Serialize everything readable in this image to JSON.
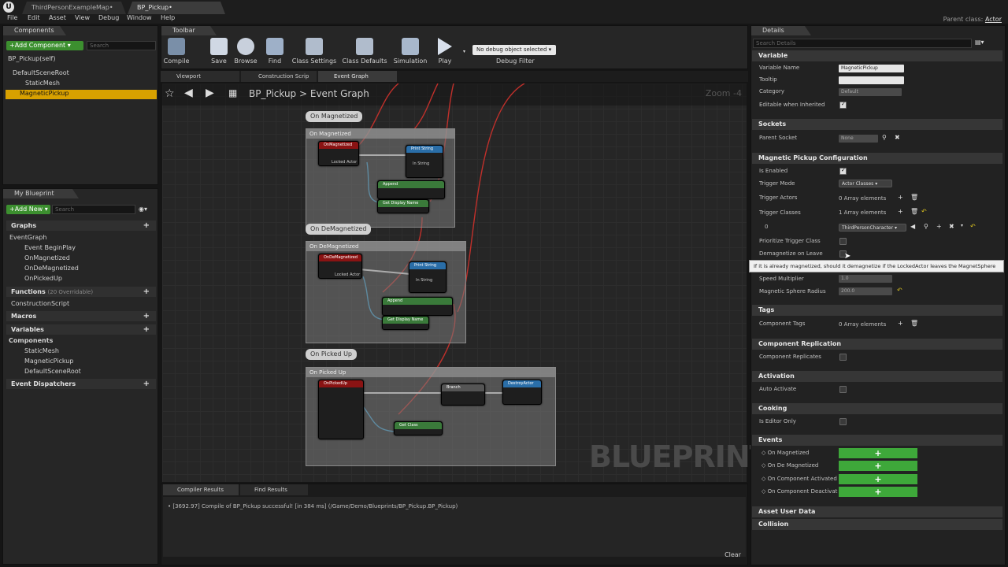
{
  "window": {
    "doc_tabs": [
      "ThirdPersonExampleMap•",
      "BP_Pickup•"
    ],
    "menu": [
      "File",
      "Edit",
      "Asset",
      "View",
      "Debug",
      "Window",
      "Help"
    ],
    "parent_class_label": "Parent class:",
    "parent_class_value": "Actor"
  },
  "components": {
    "title": "Components",
    "add_button": "+Add Component ▾",
    "search_placeholder": "Search",
    "items": [
      "BP_Pickup(self)",
      "DefaultSceneRoot",
      "StaticMesh",
      "MagneticPickup"
    ],
    "selected": "MagneticPickup"
  },
  "my_blueprint": {
    "title": "My Blueprint",
    "add_button": "+Add New ▾",
    "search_placeholder": "Search",
    "graphs_label": "Graphs",
    "event_graph": "EventGraph",
    "graph_items": [
      "Event BeginPlay",
      "OnMagnetized",
      "OnDeMagnetized",
      "OnPickedUp"
    ],
    "functions_label": "Functions",
    "functions_count": "(20 Overridable)",
    "function_items": [
      "ConstructionScript"
    ],
    "macros_label": "Macros",
    "variables_label": "Variables",
    "components_label": "Components",
    "variable_components": [
      "StaticMesh",
      "MagneticPickup",
      "DefaultSceneRoot"
    ],
    "dispatchers_label": "Event Dispatchers"
  },
  "toolbar": {
    "title": "Toolbar",
    "buttons": [
      "Compile",
      "Save",
      "Browse",
      "Find",
      "Class Settings",
      "Class Defaults",
      "Simulation",
      "Play"
    ],
    "debug_select": "No debug object selected ▾",
    "debug_filter": "Debug Filter"
  },
  "graph_tabs": [
    "Viewport",
    "Construction Scrip",
    "Event Graph"
  ],
  "graph": {
    "breadcrumb_root": "BP_Pickup",
    "breadcrumb_leaf": "Event Graph",
    "zoom": "Zoom -4",
    "watermark": "BLUEPRINT",
    "bubbles": [
      "On Magnetized",
      "On DeMagnetized",
      "On Picked Up"
    ],
    "comment_titles": [
      "On Magnetized",
      "On DeMagnetized",
      "On Picked Up"
    ],
    "node_titles": [
      "OnMagnetized",
      "Print String",
      "Append",
      "Get Display Name",
      "OnDeMagnetized",
      "Print String",
      "Append",
      "Get Display Name",
      "OnPickedUp",
      "Branch",
      "DestroyActor",
      "Get Class"
    ]
  },
  "bottom": {
    "tabs": [
      "Compiler Results",
      "Find Results"
    ],
    "log": "• [3692.97] Compile of BP_Pickup successful! [in 384 ms] (/Game/Demo/Blueprints/BP_Pickup.BP_Pickup)",
    "clear": "Clear"
  },
  "details": {
    "title": "Details",
    "search_placeholder": "Search Details",
    "variable_section": "Variable",
    "variable_name_label": "Variable Name",
    "variable_name_value": "MagneticPickup",
    "tooltip_label": "Tooltip",
    "category_label": "Category",
    "category_value": "Default",
    "editable_label": "Editable when Inherited",
    "sockets_section": "Sockets",
    "parent_socket_label": "Parent Socket",
    "parent_socket_value": "None",
    "config_section": "Magnetic Pickup Configuration",
    "is_enabled_label": "Is Enabled",
    "trigger_mode_label": "Trigger Mode",
    "trigger_mode_value": "Actor Classes ▾",
    "trigger_actors_label": "Trigger Actors",
    "trigger_actors_value": "0 Array elements",
    "trigger_classes_label": "Trigger Classes",
    "trigger_classes_value": "1 Array elements",
    "class_index": "0",
    "class_value": "ThirdPersonCharacter ▾",
    "prioritize_label": "Prioritize Trigger Class",
    "demagnetize_label": "Demagnetize on Leave",
    "tooltip_text": "If it is already magnetized, should it demagnetize if the LockedActor leaves the MagnetSphere",
    "speed_label": "Speed Multiplier",
    "speed_value": "1.0",
    "radius_label": "Magnetic Sphere Radius",
    "radius_value": "200.0",
    "tags_section": "Tags",
    "component_tags_label": "Component Tags",
    "component_tags_value": "0 Array elements",
    "replication_section": "Component Replication",
    "replicates_label": "Component Replicates",
    "activation_section": "Activation",
    "auto_activate_label": "Auto Activate",
    "cooking_section": "Cooking",
    "editor_only_label": "Is Editor Only",
    "events_section": "Events",
    "events": [
      "On Magnetized",
      "On De Magnetized",
      "On Component Activated",
      "On Component Deactivat"
    ],
    "asset_user_data_section": "Asset User Data",
    "collision_section": "Collision"
  }
}
